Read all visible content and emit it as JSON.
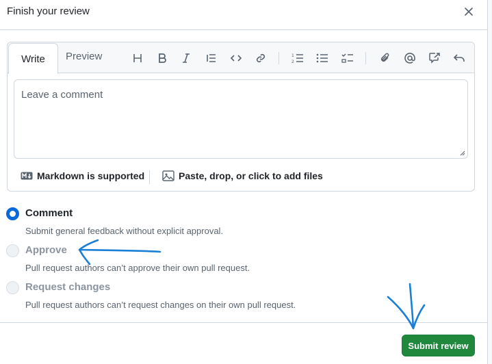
{
  "header": {
    "title": "Finish your review",
    "close_icon": "x-icon"
  },
  "editor": {
    "tabs": {
      "write": "Write",
      "preview": "Preview"
    },
    "toolbar_icons": [
      "heading-icon",
      "bold-icon",
      "italic-icon",
      "quote-icon",
      "code-icon",
      "link-icon",
      "ordered-list-icon",
      "unordered-list-icon",
      "task-list-icon",
      "attach-icon",
      "mention-icon",
      "reference-icon",
      "undo-icon"
    ],
    "placeholder": "Leave a comment",
    "markdown_note": "Markdown is supported",
    "attach_note": "Paste, drop, or click to add files"
  },
  "options": [
    {
      "label": "Comment",
      "description": "Submit general feedback without explicit approval.",
      "checked": true,
      "disabled": false
    },
    {
      "label": "Approve",
      "description": "Pull request authors can’t approve their own pull request.",
      "checked": false,
      "disabled": true
    },
    {
      "label": "Request changes",
      "description": "Pull request authors can’t request changes on their own pull request.",
      "checked": false,
      "disabled": true
    }
  ],
  "submit_label": "Submit review",
  "colors": {
    "primary": "#1f883d",
    "accent": "#0969da",
    "annotation": "#1a7fd6"
  }
}
